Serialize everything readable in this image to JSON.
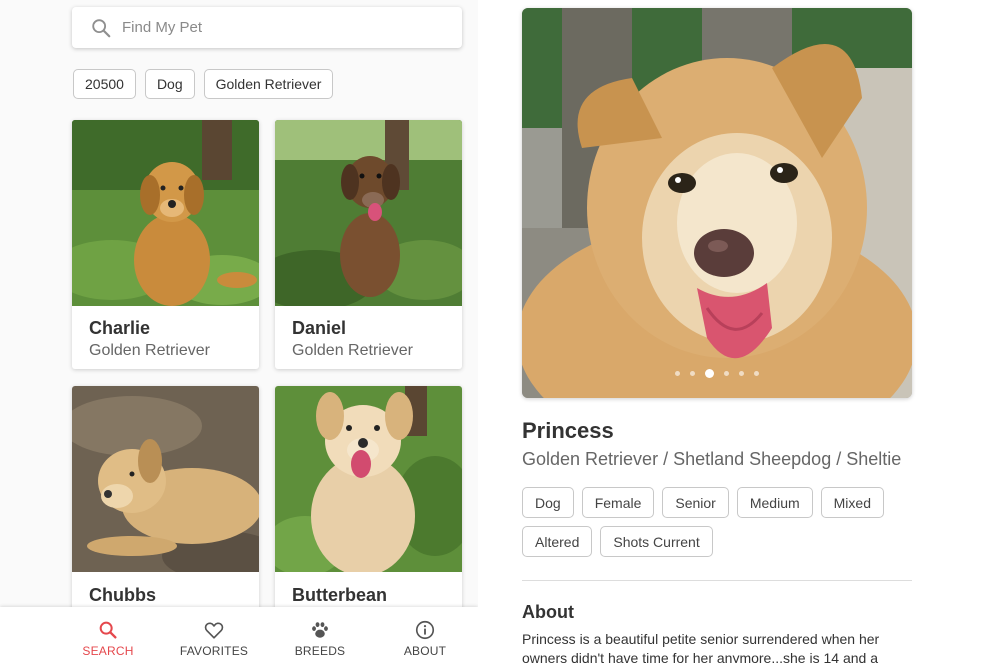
{
  "search": {
    "placeholder": "Find My Pet"
  },
  "filters": [
    "20500",
    "Dog",
    "Golden Retriever"
  ],
  "pets": [
    {
      "name": "Charlie",
      "breed": "Golden Retriever"
    },
    {
      "name": "Daniel",
      "breed": "Golden Retriever"
    },
    {
      "name": "Chubbs",
      "breed": ""
    },
    {
      "name": "Butterbean",
      "breed": ""
    }
  ],
  "nav": [
    {
      "label": "SEARCH",
      "icon": "search-icon",
      "active": true
    },
    {
      "label": "FAVORITES",
      "icon": "heart-icon",
      "active": false
    },
    {
      "label": "BREEDS",
      "icon": "paw-icon",
      "active": false
    },
    {
      "label": "ABOUT",
      "icon": "info-icon",
      "active": false
    }
  ],
  "detail": {
    "name": "Princess",
    "breed": "Golden Retriever / Shetland Sheepdog / Sheltie",
    "tags": [
      "Dog",
      "Female",
      "Senior",
      "Medium",
      "Mixed",
      "Altered",
      "Shots Current"
    ],
    "about_title": "About",
    "about_text": "Princess is a beautiful petite senior surrendered when her owners didn't have time for her anymore...she is 14 and a",
    "photo_count": 6,
    "active_photo": 3
  },
  "colors": {
    "accent": "#e5484d"
  }
}
